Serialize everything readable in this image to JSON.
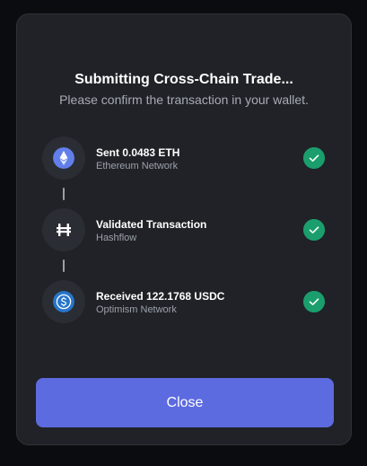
{
  "modal": {
    "title": "Submitting Cross-Chain Trade...",
    "subtitle": "Please confirm the transaction in your wallet."
  },
  "steps": [
    {
      "title": "Sent 0.0483 ETH",
      "subtitle": "Ethereum Network",
      "icon": "ethereum-icon",
      "icon_color": "#627eea",
      "status": "complete"
    },
    {
      "title": "Validated Transaction",
      "subtitle": "Hashflow",
      "icon": "hashflow-icon",
      "icon_color": "#ffffff",
      "status": "complete"
    },
    {
      "title": "Received 122.1768 USDC",
      "subtitle": "Optimism Network",
      "icon": "usdc-icon",
      "icon_color": "#2775ca",
      "status": "complete"
    }
  ],
  "close_button": {
    "label": "Close"
  },
  "colors": {
    "modal_bg": "#202227",
    "accent": "#5d6be0",
    "success": "#1b9e6d"
  }
}
